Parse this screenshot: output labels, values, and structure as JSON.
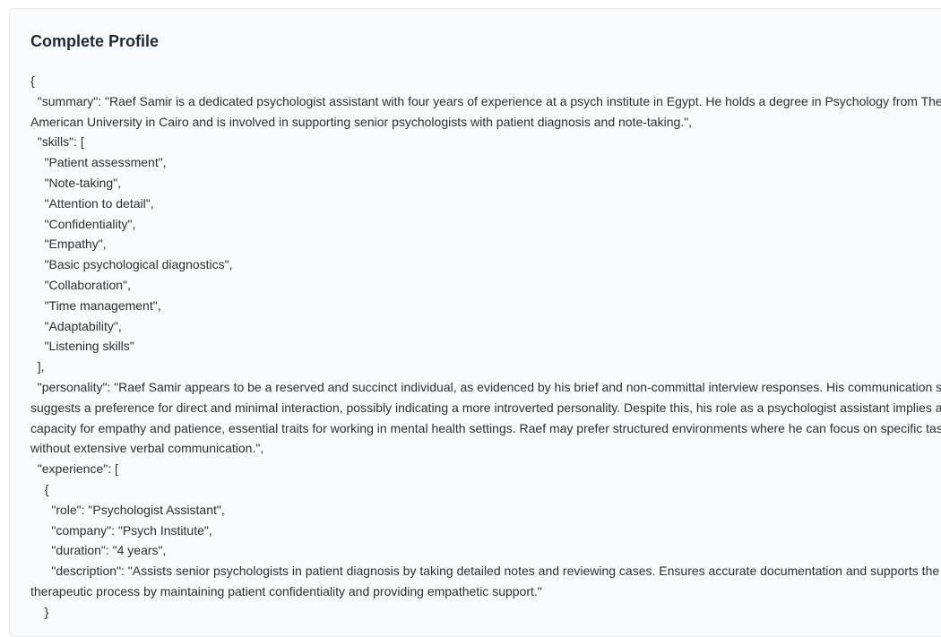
{
  "section": {
    "title": "Complete Profile"
  },
  "profile_json": "{\n  \"summary\": \"Raef Samir is a dedicated psychologist assistant with four years of experience at a psych institute in Egypt. He holds a degree in Psychology from The American University in Cairo and is involved in supporting senior psychologists with patient diagnosis and note-taking.\",\n  \"skills\": [\n    \"Patient assessment\",\n    \"Note-taking\",\n    \"Attention to detail\",\n    \"Confidentiality\",\n    \"Empathy\",\n    \"Basic psychological diagnostics\",\n    \"Collaboration\",\n    \"Time management\",\n    \"Adaptability\",\n    \"Listening skills\"\n  ],\n  \"personality\": \"Raef Samir appears to be a reserved and succinct individual, as evidenced by his brief and non-committal interview responses. His communication style suggests a preference for direct and minimal interaction, possibly indicating a more introverted personality. Despite this, his role as a psychologist assistant implies a capacity for empathy and patience, essential traits for working in mental health settings. Raef may prefer structured environments where he can focus on specific tasks without extensive verbal communication.\",\n  \"experience\": [\n    {\n      \"role\": \"Psychologist Assistant\",\n      \"company\": \"Psych Institute\",\n      \"duration\": \"4 years\",\n      \"description\": \"Assists senior psychologists in patient diagnosis by taking detailed notes and reviewing cases. Ensures accurate documentation and supports the therapeutic process by maintaining patient confidentiality and providing empathetic support.\"\n    }"
}
